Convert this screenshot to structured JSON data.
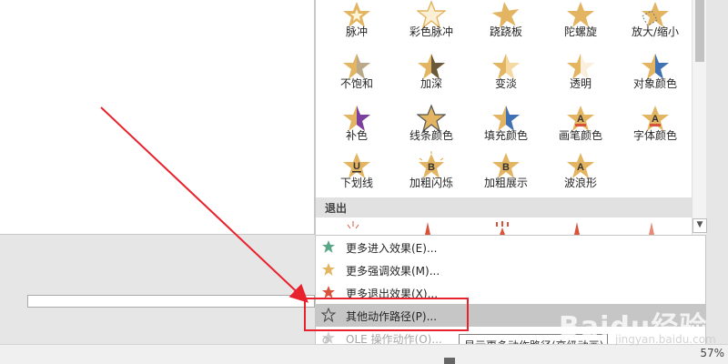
{
  "gallery": {
    "effects": [
      {
        "label": "脉冲",
        "icon": "star-pulse-icon"
      },
      {
        "label": "彩色脉冲",
        "icon": "star-color-pulse-icon"
      },
      {
        "label": "跷跷板",
        "icon": "star-teeter-icon"
      },
      {
        "label": "陀螺旋",
        "icon": "star-spin-icon"
      },
      {
        "label": "放大/缩小",
        "icon": "star-grow-shrink-icon"
      },
      {
        "label": "不饱和",
        "icon": "star-desaturate-icon"
      },
      {
        "label": "加深",
        "icon": "star-darken-icon"
      },
      {
        "label": "变淡",
        "icon": "star-lighten-icon"
      },
      {
        "label": "透明",
        "icon": "star-transparency-icon"
      },
      {
        "label": "对象颜色",
        "icon": "star-object-color-icon"
      },
      {
        "label": "补色",
        "icon": "star-complementary-color-icon"
      },
      {
        "label": "线条颜色",
        "icon": "star-line-color-icon"
      },
      {
        "label": "填充颜色",
        "icon": "star-fill-color-icon"
      },
      {
        "label": "画笔颜色",
        "icon": "star-brush-color-icon"
      },
      {
        "label": "字体颜色",
        "icon": "star-font-color-icon"
      },
      {
        "label": "下划线",
        "icon": "star-underline-icon"
      },
      {
        "label": "加粗闪烁",
        "icon": "star-bold-flash-icon"
      },
      {
        "label": "加粗展示",
        "icon": "star-bold-reveal-icon"
      },
      {
        "label": "波浪形",
        "icon": "star-wave-icon"
      }
    ],
    "exit_section_label": "退出"
  },
  "menu": {
    "items": [
      {
        "label": "更多进入效果(E)...",
        "icon": "star-green-icon"
      },
      {
        "label": "更多强调效果(M)...",
        "icon": "star-gold-icon"
      },
      {
        "label": "更多退出效果(X)...",
        "icon": "star-red-icon"
      },
      {
        "label": "其他动作路径(P)...",
        "icon": "star-outline-icon"
      },
      {
        "label": "OLE 操作动作(O)...",
        "icon": "gear-star-icon"
      }
    ]
  },
  "tooltip": "显示更多动作路径(高级动画)",
  "status": {
    "zoom": "57%"
  },
  "watermark": {
    "brand": "Baidu经验",
    "sub": "jingyan.baidu.com"
  },
  "colors": {
    "star_gold": "#e3b461",
    "highlight_red": "#e8222d",
    "menu_highlight": "#c6c6c6",
    "star_green": "#5aa788",
    "star_red": "#d9533b"
  }
}
